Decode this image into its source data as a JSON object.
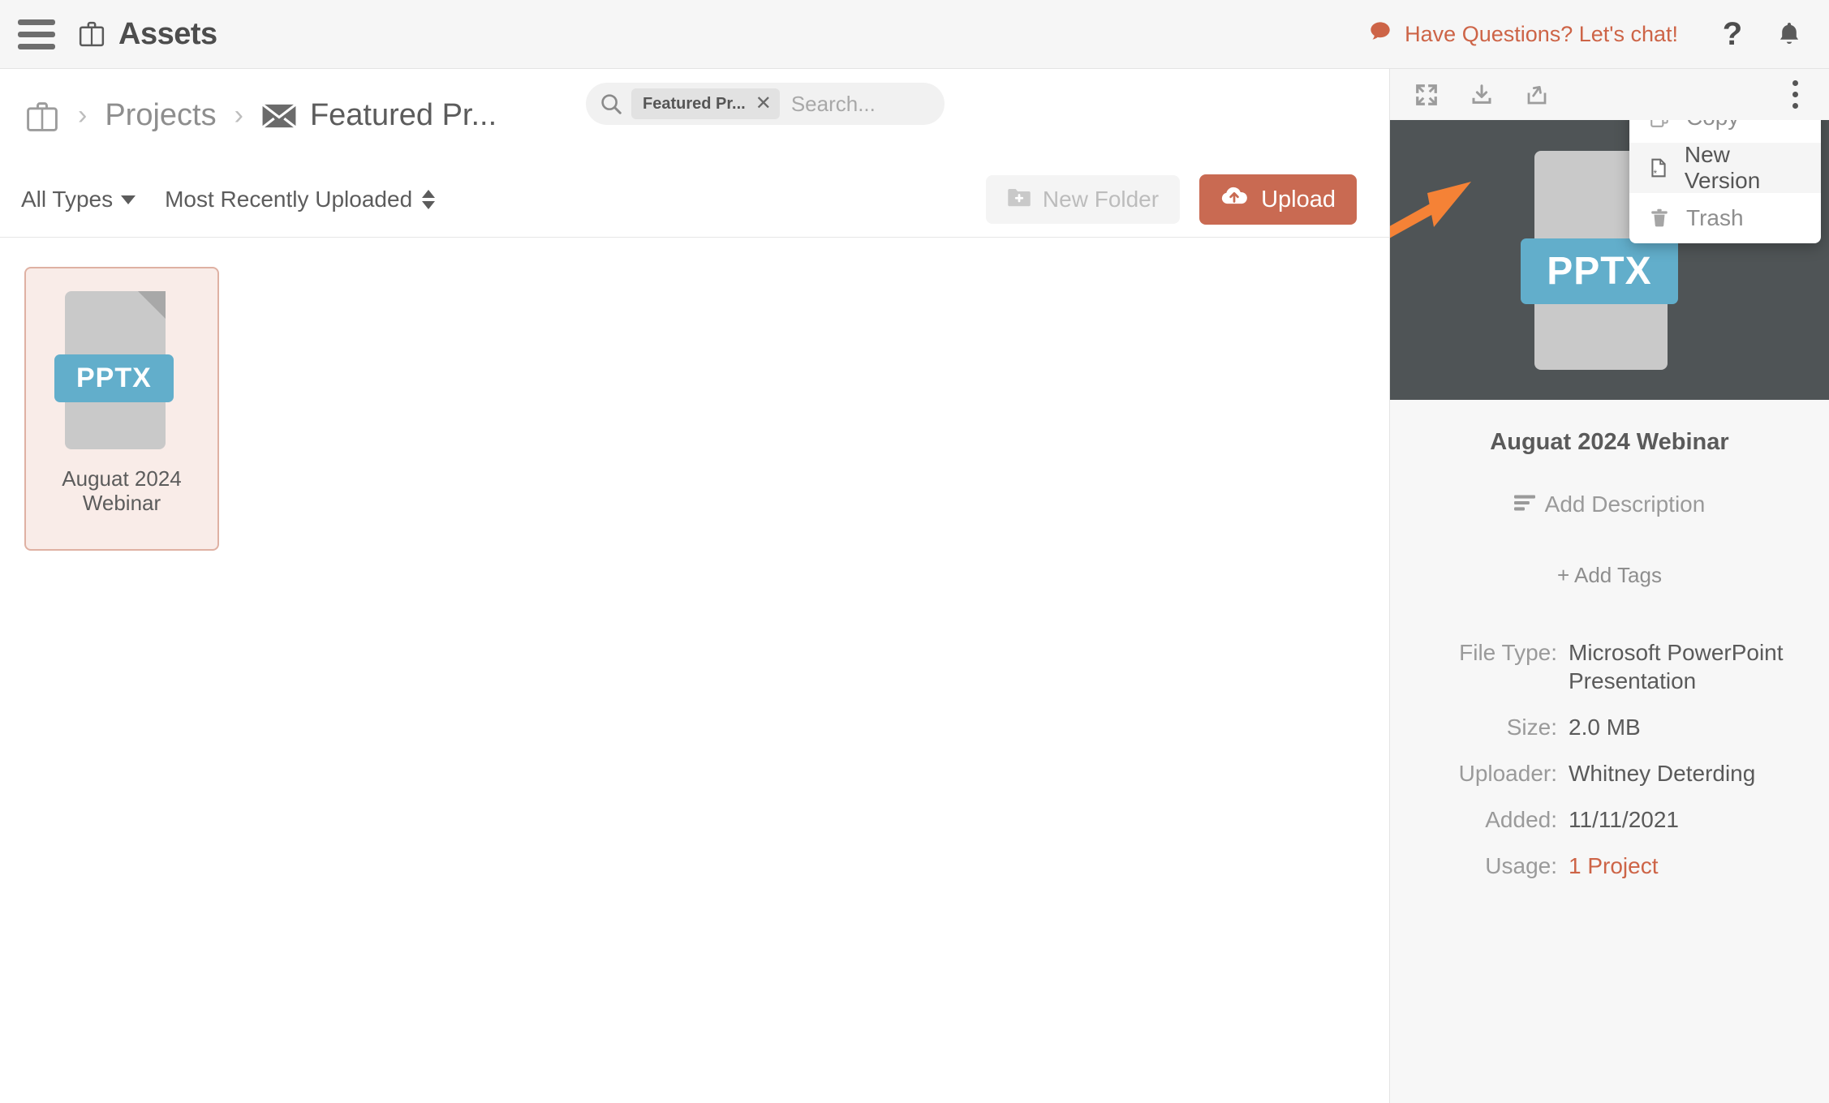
{
  "header": {
    "menu_icon": "hamburger-icon",
    "app_icon": "briefcase-icon",
    "title": "Assets",
    "chat_label": "Have Questions? Let's chat!",
    "chat_icon": "chat-bubble-icon",
    "help_icon": "?",
    "bell_icon": "bell-icon"
  },
  "breadcrumb": {
    "root_icon": "briefcase-icon",
    "separator": "›",
    "projects": "Projects",
    "current_icon": "envelope-icon",
    "current": "Featured Pr..."
  },
  "search": {
    "icon": "search-icon",
    "chip_label": "Featured Pr...",
    "chip_close": "✕",
    "placeholder": "Search...",
    "value": ""
  },
  "toolbar": {
    "type_filter": "All Types",
    "sort": "Most Recently Uploaded",
    "new_folder": "New Folder",
    "new_folder_icon": "folder-plus-icon",
    "upload": "Upload",
    "upload_icon": "cloud-upload-icon"
  },
  "files": [
    {
      "name_line1": "Auguat 2024",
      "name_line2": "Webinar",
      "extension": "PPTX",
      "selected": true
    }
  ],
  "panel": {
    "tools": {
      "expand_icon": "expand-icon",
      "download_icon": "download-icon",
      "share_icon": "share-icon",
      "menu_icon": "kebab-menu-icon"
    },
    "preview_extension": "PPTX",
    "dropdown": [
      {
        "label": "Copy",
        "icon": "copy-icon",
        "highlighted": false
      },
      {
        "label": "New Version",
        "icon": "new-document-icon",
        "highlighted": true
      },
      {
        "label": "Trash",
        "icon": "trash-icon",
        "highlighted": false
      }
    ],
    "asset_title": "Auguat 2024 Webinar",
    "add_description": "Add Description",
    "add_description_icon": "description-lines-icon",
    "add_tags": "+ Add Tags",
    "metadata": [
      {
        "key": "File Type:",
        "value": "Microsoft PowerPoint Presentation",
        "link": false
      },
      {
        "key": "Size:",
        "value": "2.0 MB",
        "link": false
      },
      {
        "key": "Uploader:",
        "value": "Whitney Deterding",
        "link": false
      },
      {
        "key": "Added:",
        "value": "11/11/2021",
        "link": false
      },
      {
        "key": "Usage:",
        "value": "1 Project",
        "link": true
      }
    ]
  },
  "colors": {
    "accent": "#cd6447",
    "upload_button": "#c96a52",
    "pptx_badge": "#62aecb",
    "preview_bg": "#4f5456",
    "card_bg": "#f9ece8",
    "card_border": "#dfb1a3",
    "annotation_arrow": "#f58236"
  }
}
